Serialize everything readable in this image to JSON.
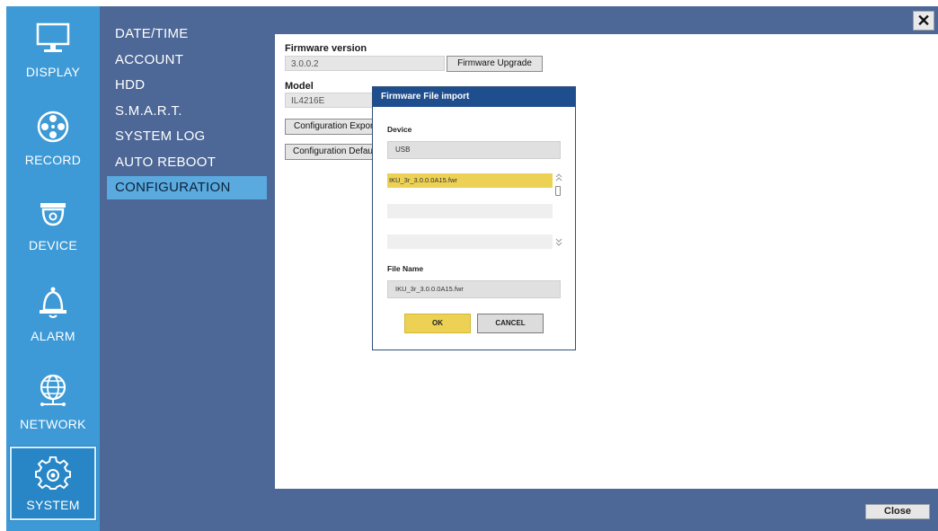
{
  "rail": {
    "items": [
      {
        "label": "DISPLAY",
        "icon": "monitor-icon"
      },
      {
        "label": "RECORD",
        "icon": "film-reel-icon"
      },
      {
        "label": "DEVICE",
        "icon": "dome-camera-icon"
      },
      {
        "label": "ALARM",
        "icon": "bell-icon"
      },
      {
        "label": "NETWORK",
        "icon": "globe-network-icon"
      },
      {
        "label": "SYSTEM",
        "icon": "gear-icon"
      }
    ],
    "active": "SYSTEM"
  },
  "submenu": {
    "items": [
      "DATE/TIME",
      "ACCOUNT",
      "HDD",
      "S.M.A.R.T.",
      "SYSTEM LOG",
      "AUTO REBOOT",
      "CONFIGURATION"
    ],
    "active": "CONFIGURATION"
  },
  "panel": {
    "firmware_label": "Firmware version",
    "firmware_value": "3.0.0.2",
    "upgrade_button": "Firmware Upgrade",
    "model_label": "Model",
    "model_value": "IL4216E",
    "export_button": "Configuration Export",
    "default_button": "Configuration Default"
  },
  "dialog": {
    "title": "Firmware File import",
    "device_label": "Device",
    "device_value": "USB",
    "files": [
      "IKU_3r_3.0.0.0A15.fwr",
      "",
      ""
    ],
    "filename_label": "File Name",
    "filename_value": "IKU_3r_3.0.0.0A15.fwr",
    "ok_button": "OK",
    "cancel_button": "CANCEL"
  },
  "footer": {
    "close_button": "Close"
  },
  "colors": {
    "rail": "#3d9ad6",
    "menu": "#4d6796",
    "active_menu": "#5aaae0",
    "dialog_title": "#1f4e8f",
    "accent_yellow": "#ecd154"
  }
}
